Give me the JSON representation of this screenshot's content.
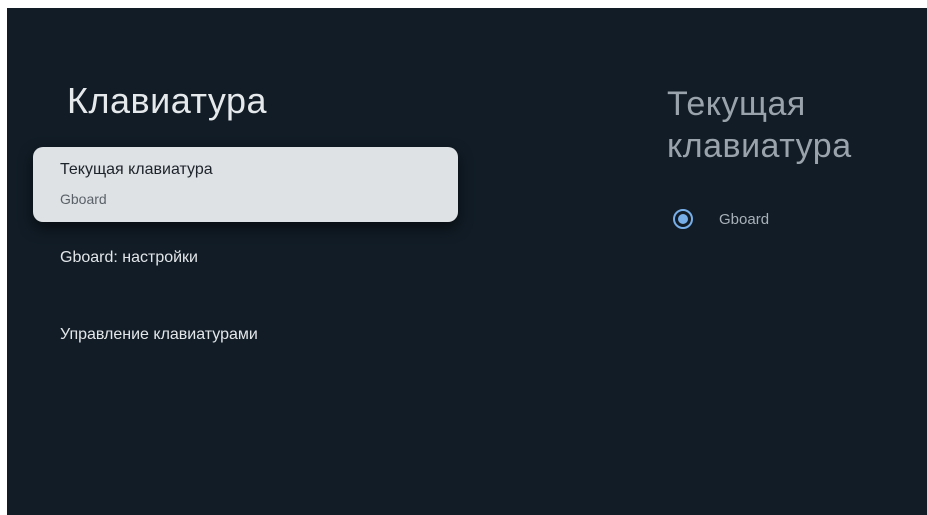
{
  "left_panel": {
    "title": "Клавиатура",
    "items": [
      {
        "label": "Текущая клавиатура",
        "sublabel": "Gboard",
        "selected": true
      },
      {
        "label": "Gboard: настройки"
      },
      {
        "label": "Управление клавиатурами"
      }
    ]
  },
  "right_panel": {
    "title": "Текущая клавиатура",
    "options": [
      {
        "label": "Gboard",
        "checked": true,
        "icon": "radio-checked-icon"
      }
    ]
  },
  "colors": {
    "background": "#111c26",
    "selected_item": "#dee2e5",
    "radio_accent": "#77aee8"
  }
}
